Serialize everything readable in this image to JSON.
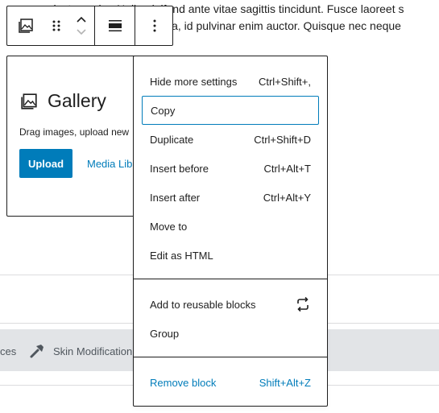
{
  "background": {
    "line1": "nec luctus enim. Nulla eleifend ante vitae sagittis tincidunt. Fusce laoreet s",
    "line2": "la, id pulvinar enim auctor. Quisque nec neque"
  },
  "toolbar": {
    "block_type_icon": "gallery-icon",
    "drag_icon": "drag-handle-icon",
    "move_up_icon": "chevron-up-icon",
    "move_down_icon": "chevron-down-icon",
    "align_icon": "align-icon",
    "more_icon": "more-vertical-icon"
  },
  "gallery": {
    "title": "Gallery",
    "instructions": "Drag images, upload new",
    "upload_label": "Upload",
    "media_library_label": "Media Libr"
  },
  "graybar": {
    "item1": "ces",
    "item2": "Skin Modification"
  },
  "menu": {
    "groups": [
      {
        "items": [
          {
            "label": "Hide more settings",
            "shortcut": "Ctrl+Shift+,"
          },
          {
            "label": "Copy",
            "shortcut": ""
          },
          {
            "label": "Duplicate",
            "shortcut": "Ctrl+Shift+D"
          },
          {
            "label": "Insert before",
            "shortcut": "Ctrl+Alt+T"
          },
          {
            "label": "Insert after",
            "shortcut": "Ctrl+Alt+Y"
          },
          {
            "label": "Move to",
            "shortcut": ""
          },
          {
            "label": "Edit as HTML",
            "shortcut": ""
          }
        ]
      },
      {
        "items": [
          {
            "label": "Add to reusable blocks",
            "icon": "reusable-block-icon"
          },
          {
            "label": "Group",
            "shortcut": ""
          }
        ]
      },
      {
        "items": [
          {
            "label": "Remove block",
            "shortcut": "Shift+Alt+Z"
          }
        ]
      }
    ]
  },
  "colors": {
    "accent": "#007cba",
    "text": "#1e1e1e",
    "graybar": "#e2e4e7"
  }
}
